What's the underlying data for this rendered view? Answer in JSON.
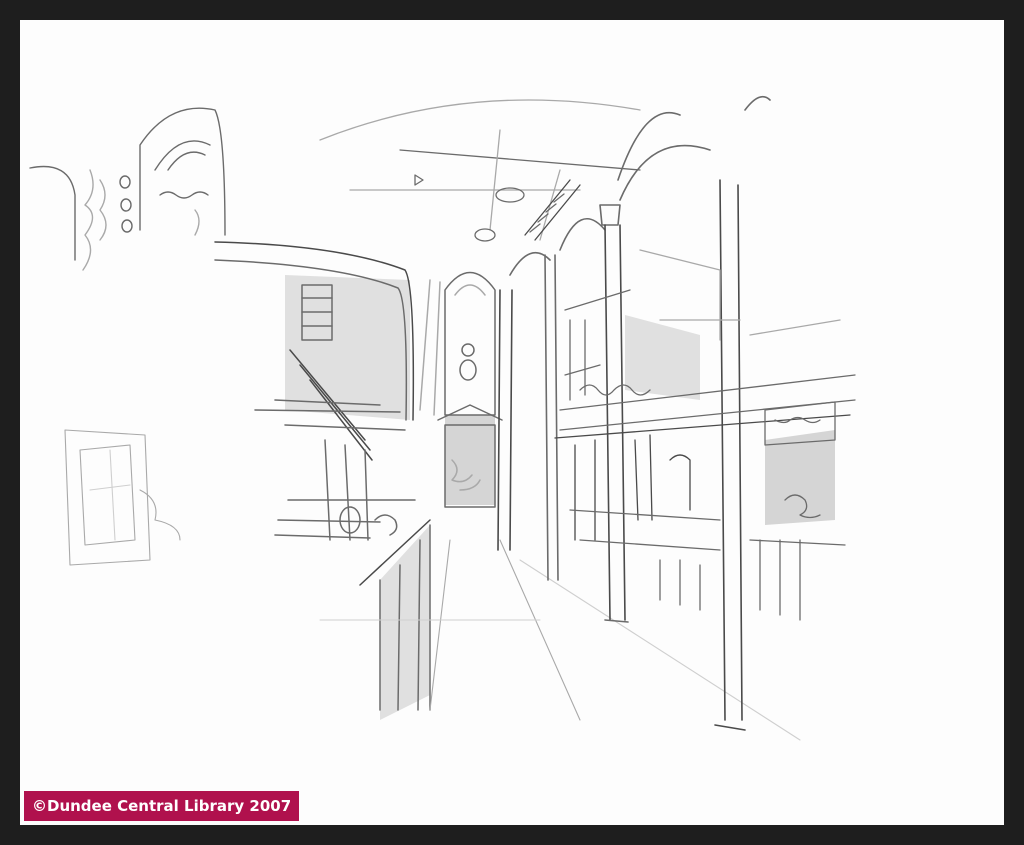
{
  "image": {
    "description_kind": "pencil sketch",
    "frame_color": "#1e1e1e",
    "paper_color": "#fdfdfd"
  },
  "credit": {
    "text": "©Dundee Central Library 2007",
    "background": "#b0114d",
    "color": "#ffffff"
  }
}
